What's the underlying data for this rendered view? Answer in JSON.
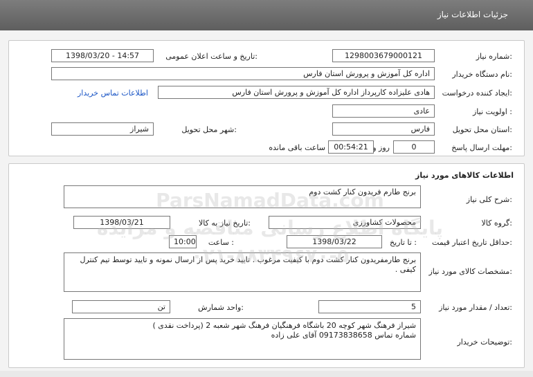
{
  "header": {
    "title": "جزئیات اطلاعات نیاز"
  },
  "info": {
    "need_number_label": "شماره نیاز:",
    "need_number": "1298003679000121",
    "announce_label": "تاریخ و ساعت اعلان عمومی:",
    "announce_value": "1398/03/20 - 14:57",
    "buyer_org_label": "نام دستگاه خریدار:",
    "buyer_org": "اداره کل آموزش و پرورش استان فارس",
    "creator_label": "ایجاد کننده درخواست:",
    "creator": "هادی علیزاده کارپرداز اداره کل آموزش و پرورش استان فارس",
    "contact_link": "اطلاعات تماس خریدار",
    "priority_label": "اولویت نیاز :",
    "priority": "عادی",
    "province_label": "استان محل تحویل:",
    "province": "فارس",
    "city_label": "شهر محل تحویل:",
    "city": "شیراز",
    "deadline_label": "مهلت ارسال پاسخ:",
    "days": "0",
    "days_unit": "روز و",
    "time": "00:54:21",
    "remaining": "ساعت باقی مانده"
  },
  "goods": {
    "section_title": "اطلاعات کالاهای مورد نیاز",
    "summary_label": "شرح کلی نیاز:",
    "summary": "برنج طارم فریدون کنار  کشت دوم",
    "group_label": "گروه کالا:",
    "group": "محصولات کشاورزی",
    "need_date_label": "تاریخ نیاز به کالا:",
    "need_date": "1398/03/21",
    "validity_label": "حداقل تاریخ اعتبار قیمت:",
    "to_date_label": "تا تاریخ :",
    "to_date": "1398/03/22",
    "hour_label": "ساعت :",
    "hour": "10:00",
    "specs_label": "مشخصات کالای مورد نیاز:",
    "specs": "برنج طارمفریدون کنار  کشت دوم با کیفیت مرغوب . تایید خرید پس از ارسال نمونه و تایید توسط تیم کنترل کیفی .",
    "qty_label": "تعداد / مقدار مورد نیاز:",
    "qty": "5",
    "unit_label": "واحد شمارش:",
    "unit": "تن",
    "desc_label": "توضیحات خریدار:",
    "desc_line1": "شیراز فرهنگ شهر کوچه 20 باشگاه فرهنگیان فرهنگ شهر شعبه 2    (پرداخت نقدی )",
    "desc_line2": "شماره تماس 09173838658 آقای علی زاده"
  },
  "watermark": {
    "line1": "ParsNamadData.com",
    "line2": "پایگاه اطلاع رسانی مناقصه و مزایده",
    "line3": "۰۲۱-۸۸۳۴۹۶۷۰-۵"
  }
}
